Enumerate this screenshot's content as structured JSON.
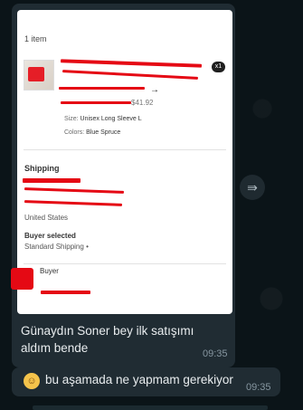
{
  "screenshot": {
    "items_count": "1 item",
    "qty_badge": "x1",
    "price": "$41.92",
    "size_label": "Size:",
    "size_value": "Unisex Long Sleeve L",
    "colors_label": "Colors:",
    "colors_value": "Blue Spruce",
    "shipping_title": "Shipping",
    "country": "United States",
    "buyer_selected_title": "Buyer selected",
    "shipping_method": "Standard Shipping",
    "shipping_bullet": "•",
    "buyer_label": "Buyer"
  },
  "messages": [
    {
      "text": "Günaydın Soner bey ilk satışımı aldım bende",
      "time": "09:35"
    },
    {
      "text": "bu aşamada ne yapmam gerekiyor",
      "time": "09:35",
      "emoji": "smiling-face-icon"
    }
  ],
  "colors": {
    "chat_bg": "#0b1418",
    "bubble_bg": "#202c33",
    "redaction": "#e50914",
    "text_primary": "#e9edef",
    "text_time": "#8696a0"
  }
}
